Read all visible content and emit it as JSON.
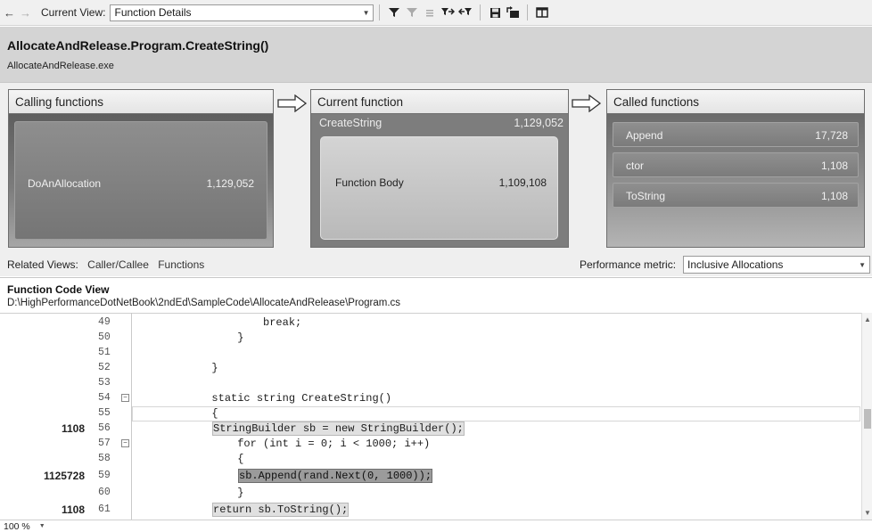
{
  "toolbar": {
    "back_icon": "arrow-left",
    "forward_icon": "arrow-right",
    "current_view_label": "Current View:",
    "current_view_value": "Function Details",
    "buttons": [
      "filter-icon",
      "clear-filter-icon",
      "highlight-icon",
      "show-callers-icon",
      "show-callees-icon",
      "save-icon",
      "export-icon",
      "split-view-icon"
    ]
  },
  "header": {
    "function_name": "AllocateAndRelease.Program.CreateString()",
    "module": "AllocateAndRelease.exe"
  },
  "calling": {
    "title": "Calling functions",
    "items": [
      {
        "name": "DoAnAllocation",
        "value": "1,129,052"
      }
    ]
  },
  "current": {
    "title": "Current function",
    "name": "CreateString",
    "value": "1,129,052",
    "body_name": "Function Body",
    "body_value": "1,109,108"
  },
  "called": {
    "title": "Called functions",
    "items": [
      {
        "name": "Append",
        "value": "17,728"
      },
      {
        "name": "ctor",
        "value": "1,108"
      },
      {
        "name": "ToString",
        "value": "1,108"
      }
    ]
  },
  "related": {
    "label": "Related Views:",
    "links": [
      "Caller/Callee",
      "Functions"
    ]
  },
  "performance": {
    "label": "Performance metric:",
    "value": "Inclusive Allocations"
  },
  "code_view": {
    "title": "Function Code View",
    "path": "D:\\HighPerformanceDotNetBook\\2ndEd\\SampleCode\\AllocateAndRelease\\Program.cs",
    "lines": [
      {
        "metric": "",
        "num": "49",
        "text": "                    break;"
      },
      {
        "metric": "",
        "num": "50",
        "text": "                }"
      },
      {
        "metric": "",
        "num": "51",
        "text": ""
      },
      {
        "metric": "",
        "num": "52",
        "text": "            }"
      },
      {
        "metric": "",
        "num": "53",
        "text": ""
      },
      {
        "metric": "",
        "num": "54",
        "text": "            static string CreateString()"
      },
      {
        "metric": "",
        "num": "55",
        "text": "            {"
      },
      {
        "metric": "1108",
        "num": "56",
        "text": "StringBuilder sb = new StringBuilder();"
      },
      {
        "metric": "",
        "num": "57",
        "text": "                for (int i = 0; i < 1000; i++)"
      },
      {
        "metric": "",
        "num": "58",
        "text": "                {"
      },
      {
        "metric": "1125728",
        "num": "59",
        "text": "sb.Append(rand.Next(0, 1000));"
      },
      {
        "metric": "",
        "num": "60",
        "text": "                }"
      },
      {
        "metric": "1108",
        "num": "61",
        "text": "return sb.ToString();"
      }
    ]
  },
  "status": {
    "zoom": "100 %"
  }
}
